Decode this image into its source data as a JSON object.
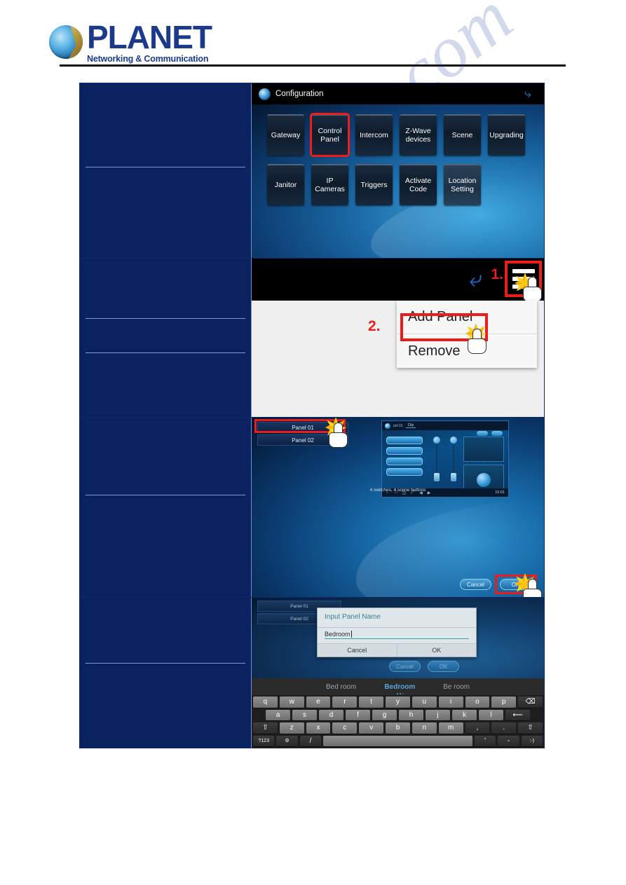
{
  "header": {
    "brand": "PLANET",
    "tagline": "Networking & Communication",
    "logo_icon": "planet-globe-logo"
  },
  "watermark": {
    "text": "manualslive.com"
  },
  "steps": [
    {
      "id": "configuration",
      "screen": {
        "title": "Configuration",
        "title_icon": "globe-icon",
        "back_icon": "back-arrow-icon",
        "buttons_row1": [
          {
            "label": "Gateway",
            "highlighted": false
          },
          {
            "label": "Control Panel",
            "highlighted": true
          },
          {
            "label": "Intercom",
            "highlighted": false
          },
          {
            "label": "Z-Wave devices",
            "highlighted": false
          },
          {
            "label": "Scene",
            "highlighted": false
          },
          {
            "label": "Upgrading",
            "highlighted": false
          }
        ],
        "buttons_row2": [
          {
            "label": "Janitor",
            "highlighted": false
          },
          {
            "label": "IP Cameras",
            "highlighted": false
          },
          {
            "label": "Triggers",
            "highlighted": false
          },
          {
            "label": "Activate Code",
            "highlighted": false
          },
          {
            "label": "Location Setting",
            "highlighted": false
          }
        ]
      }
    },
    {
      "id": "add-panel-menu",
      "screen": {
        "step1_marker": "1.",
        "step2_marker": "2.",
        "menu_icon": "hamburger-menu-icon",
        "back_icon": "back-arrow-icon",
        "menu_items": [
          {
            "label": "Add Panel",
            "highlighted": true
          },
          {
            "label": "Remove",
            "highlighted": false
          }
        ]
      }
    },
    {
      "id": "panel-select",
      "screen": {
        "panels": [
          {
            "label": "Panel 01",
            "selected": true
          },
          {
            "label": "Panel 02",
            "selected": false
          }
        ],
        "caption": "4 switches, 4 scene buttons",
        "device_preview": {
          "title": "pnl 01",
          "tab": "City",
          "clock": "15:01",
          "globe_icon": "globe-icon",
          "search_icon": "search-icon",
          "nav_icons": [
            "back-icon",
            "home-icon",
            "recent-icon",
            "fullscreen-icon",
            "volume-down-icon",
            "volume-up-icon"
          ]
        },
        "buttons": [
          {
            "label": "Cancel",
            "highlighted": false
          },
          {
            "label": "OK",
            "highlighted": true
          }
        ]
      }
    },
    {
      "id": "panel-name-input",
      "screen": {
        "ghost_panels": [
          {
            "label": "Panel 01"
          },
          {
            "label": "Panel 02"
          }
        ],
        "dialog": {
          "title": "Input Panel Name",
          "input_value": "Bedroom",
          "buttons": [
            {
              "label": "Cancel"
            },
            {
              "label": "OK"
            }
          ]
        },
        "ghost_buttons": [
          {
            "label": "Cancel"
          },
          {
            "label": "OK"
          }
        ],
        "suggestions": [
          {
            "label": "Bed room",
            "active": false
          },
          {
            "label": "Bedroom",
            "active": true
          },
          {
            "label": "Be room",
            "active": false
          }
        ],
        "keyboard": {
          "row1": [
            "q",
            "w",
            "e",
            "r",
            "t",
            "y",
            "u",
            "i",
            "o",
            "p"
          ],
          "row1_extra": {
            "label": "⌫",
            "icon": "backspace-icon"
          },
          "row2": [
            "a",
            "s",
            "d",
            "f",
            "g",
            "h",
            "j",
            "k",
            "l"
          ],
          "row2_extra": {
            "label": "⟵",
            "icon": "enter-icon"
          },
          "row3_shift_left": {
            "label": "⇧",
            "icon": "shift-icon"
          },
          "row3": [
            "z",
            "x",
            "c",
            "v",
            "b",
            "n",
            "m",
            ",",
            "."
          ],
          "row3_shift_right": {
            "label": "⇧",
            "icon": "shift-icon"
          },
          "row4": [
            {
              "label": "?123",
              "icon": "symbols-key"
            },
            {
              "label": "⚙",
              "icon": "settings-key-icon"
            },
            {
              "label": "/",
              "icon": "slash-key"
            },
            {
              "label": "",
              "icon": "space-key"
            },
            {
              "label": "'",
              "icon": "apostrophe-key"
            },
            {
              "label": "-",
              "icon": "hyphen-key"
            },
            {
              "label": ":-)",
              "icon": "emoji-key"
            }
          ]
        }
      }
    }
  ]
}
